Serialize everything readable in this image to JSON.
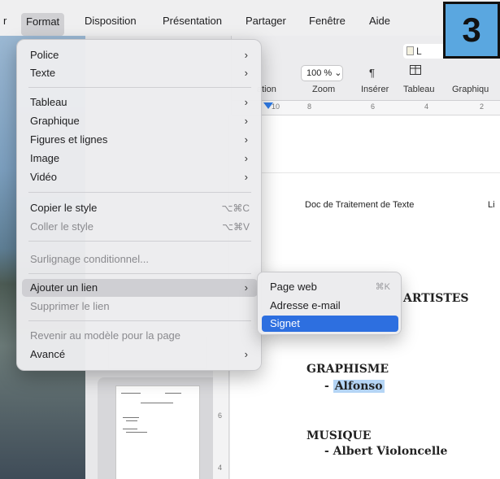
{
  "menubar": {
    "items": [
      "r",
      "Format",
      "Disposition",
      "Présentation",
      "Partager",
      "Fenêtre",
      "Aide"
    ]
  },
  "toolbar": {
    "doc_chip": "L",
    "zoom_value": "100 % ⌄",
    "labels": [
      "ation",
      "Zoom",
      "Insérer",
      "Tableau",
      "Graphiqu"
    ]
  },
  "ruler": {
    "numbers": [
      "10",
      "8",
      "6",
      "4",
      "2"
    ]
  },
  "vruler": {
    "numbers": [
      "6",
      "4"
    ]
  },
  "format_menu": {
    "items": [
      {
        "label": "Police",
        "chevron": "›"
      },
      {
        "label": "Texte",
        "chevron": "›"
      },
      {
        "label": "Tableau",
        "chevron": "›"
      },
      {
        "label": "Graphique",
        "chevron": "›"
      },
      {
        "label": "Figures et lignes",
        "chevron": "›"
      },
      {
        "label": "Image",
        "chevron": "›"
      },
      {
        "label": "Vidéo",
        "chevron": "›"
      },
      {
        "label": "Copier le style",
        "shortcut": "⌥⌘C"
      },
      {
        "label": "Coller le style",
        "shortcut": "⌥⌘V"
      },
      {
        "label": "Surlignage conditionnel..."
      },
      {
        "label": "Ajouter un lien",
        "chevron": "›"
      },
      {
        "label": "Supprimer le lien"
      },
      {
        "label": "Revenir au modèle pour la page"
      },
      {
        "label": "Avancé",
        "chevron": "›"
      }
    ]
  },
  "submenu": {
    "items": [
      {
        "label": "Page web",
        "shortcut": "⌘K"
      },
      {
        "label": "Adresse e-mail"
      },
      {
        "label": "Signet"
      }
    ]
  },
  "document": {
    "header_left": "Doc de Traitement de Texte",
    "header_right": "Li",
    "artistes": "ARTISTES",
    "graphisme_title": "GRAPHISME",
    "graphisme_item": "Alfonso",
    "musique_title": "MUSIQUE",
    "musique_item": "- Albert Violoncelle",
    "dash": "- "
  },
  "step_badge": "3"
}
